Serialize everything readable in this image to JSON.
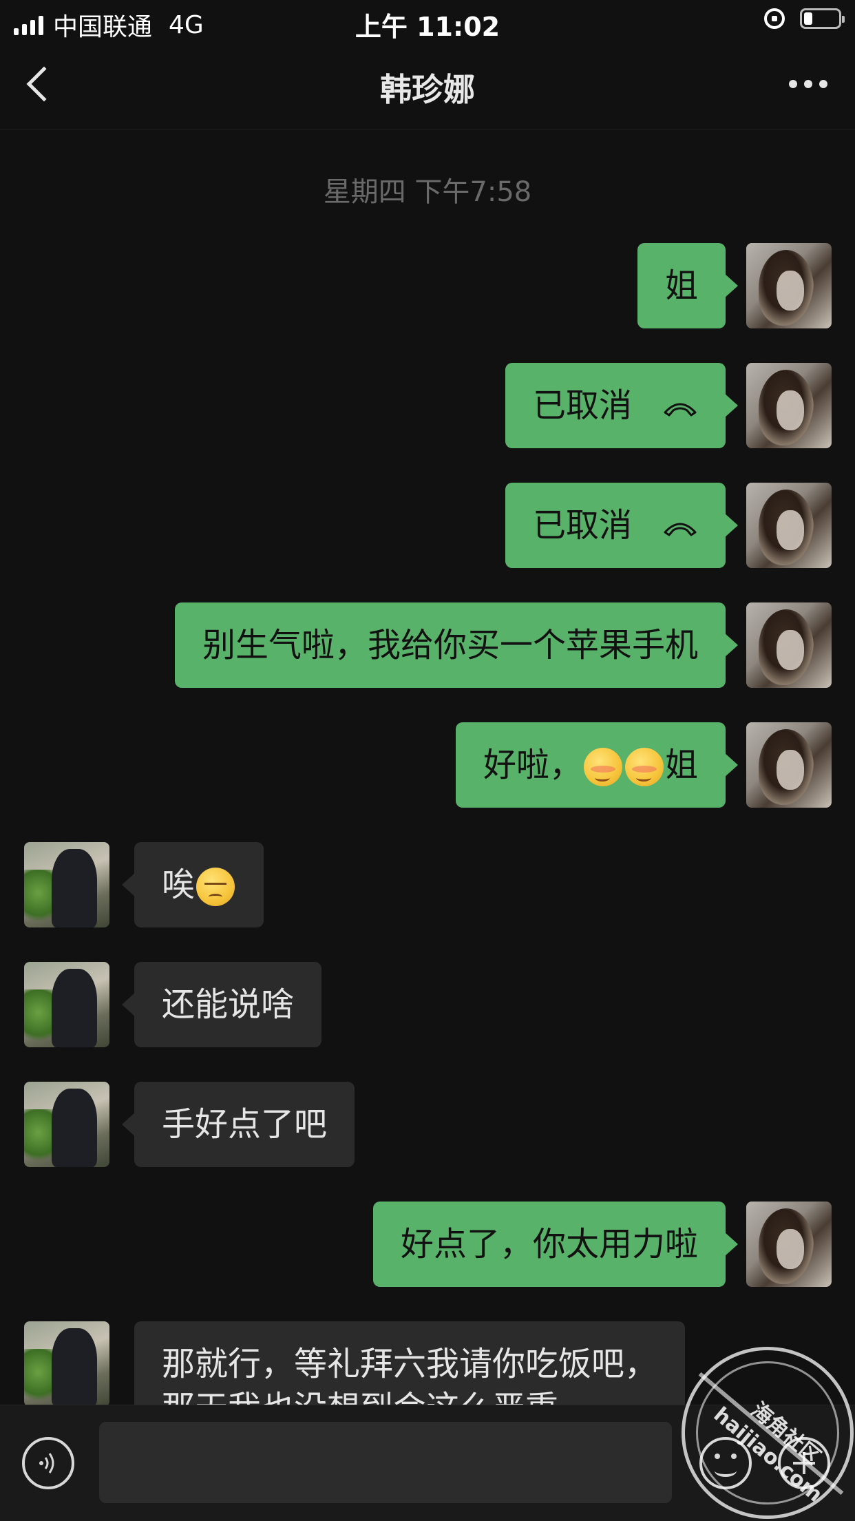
{
  "status_bar": {
    "carrier": "中国联通",
    "network": "4G",
    "time": "上午 11:02",
    "battery_level_percent": 25
  },
  "nav": {
    "title": "韩珍娜"
  },
  "timestamp": "星期四 下午7:58",
  "messages": [
    {
      "sender": "me",
      "text": "姐"
    },
    {
      "sender": "me",
      "text": "已取消",
      "icon": "phone-hangup-icon"
    },
    {
      "sender": "me",
      "text": "已取消",
      "icon": "phone-hangup-icon"
    },
    {
      "sender": "me",
      "text": "别生气啦，我给你买一个苹果手机"
    },
    {
      "sender": "me",
      "text_before": "好啦，",
      "emojis": [
        "blush-emoji",
        "blush-emoji"
      ],
      "text_after": "姐"
    },
    {
      "sender": "her",
      "text": "唉",
      "emoji": "pensive-emoji"
    },
    {
      "sender": "her",
      "text": "还能说啥"
    },
    {
      "sender": "her",
      "text": "手好点了吧"
    },
    {
      "sender": "me",
      "text": "好点了，你太用力啦"
    },
    {
      "sender": "her",
      "line1": "那就行，等礼拜六我请你吃饭吧，",
      "line2": "那天我也没想到会这么严重"
    }
  ],
  "input_bar": {
    "placeholder": ""
  },
  "watermark": {
    "line1": "海角社区",
    "line2": "haijiao.com"
  },
  "colors": {
    "background": "#111111",
    "my_bubble": "#59b26a",
    "her_bubble": "#2b2b2b"
  }
}
